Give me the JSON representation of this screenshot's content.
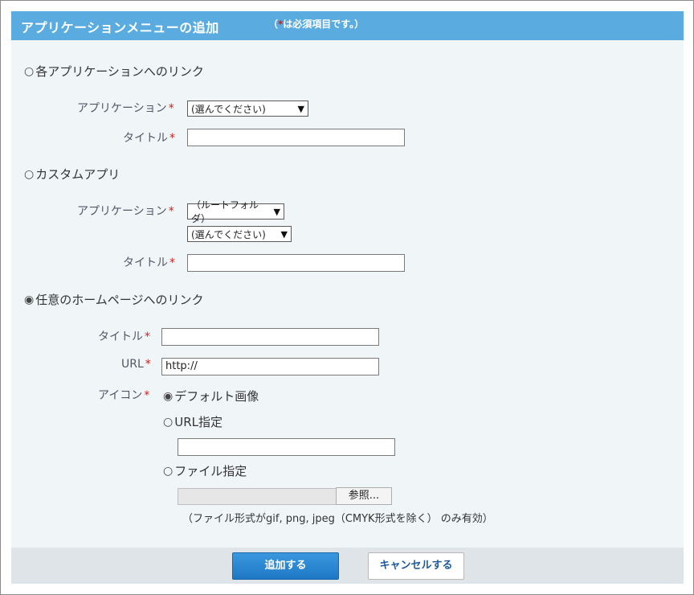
{
  "dialog": {
    "title": "アプリケーションメニューの追加",
    "note_prefix": "（",
    "note_star": "*",
    "note_text": "は必須項目です。）"
  },
  "option_app_link": {
    "radio": "○",
    "label": "各アプリケーションへのリンク",
    "selected": false,
    "app_label": "アプリケーション",
    "app_select": "(選んでください)",
    "title_label": "タイトル",
    "title_value": ""
  },
  "option_custom_app": {
    "radio": "○",
    "label": "カスタムアプリ",
    "selected": false,
    "app_label": "アプリケーション",
    "folder_select": "（ルートフォルダ）",
    "app_select": "(選んでください)",
    "title_label": "タイトル",
    "title_value": ""
  },
  "option_homepage": {
    "radio": "◉",
    "label": "任意のホームページへのリンク",
    "selected": true,
    "title_label": "タイトル",
    "title_value": "",
    "url_label": "URL",
    "url_value": "http://",
    "icon_label": "アイコン",
    "icon_options": [
      {
        "radio": "◉",
        "label": "デフォルト画像",
        "selected": true
      },
      {
        "radio": "○",
        "label": "URL指定",
        "selected": false
      },
      {
        "radio": "○",
        "label": "ファイル指定",
        "selected": false
      }
    ],
    "icon_url_value": "",
    "browse_label": "参照...",
    "file_note": "（ファイル形式がgif, png, jpeg（CMYK形式を除く） のみ有効）"
  },
  "required_mark": "*",
  "dropdown_arrow": "▼",
  "footer": {
    "add_label": "追加する",
    "cancel_label": "キャンセルする"
  },
  "colors": {
    "header_bg": "#5aace0",
    "panel_bg": "#f0f5f8",
    "required": "#cc1f1f",
    "primary_button": "#2a86d0",
    "footer_bg": "#dfe4e8"
  }
}
